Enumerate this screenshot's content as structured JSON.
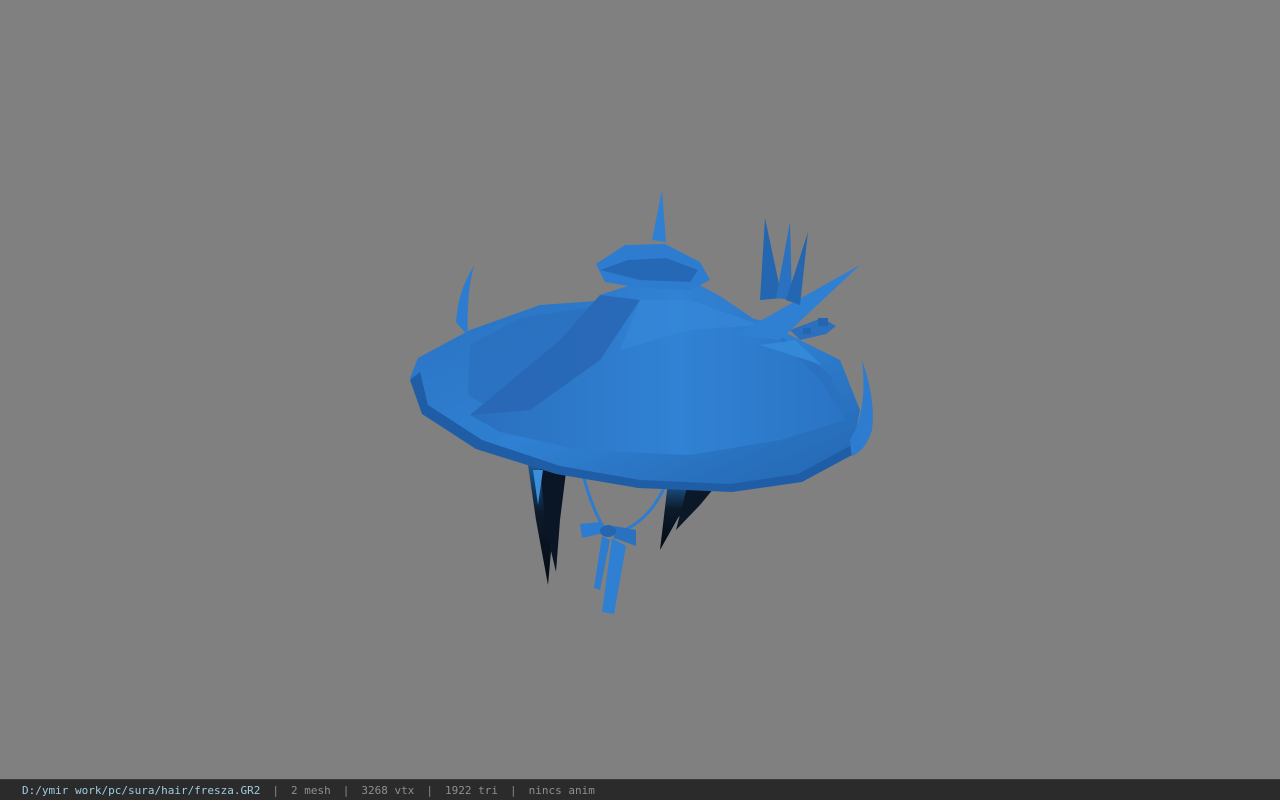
{
  "viewport": {
    "background_color": "#808080",
    "model_color": "#2e7ccf",
    "hair_color": "#0e2236"
  },
  "status_bar": {
    "file_path": "D:/ymir work/pc/sura/hair/fresza.GR2",
    "separator": "|",
    "mesh_count": "2 mesh",
    "vertex_count": "3268 vtx",
    "triangle_count": "1922 tri",
    "animation": "nincs anim"
  }
}
